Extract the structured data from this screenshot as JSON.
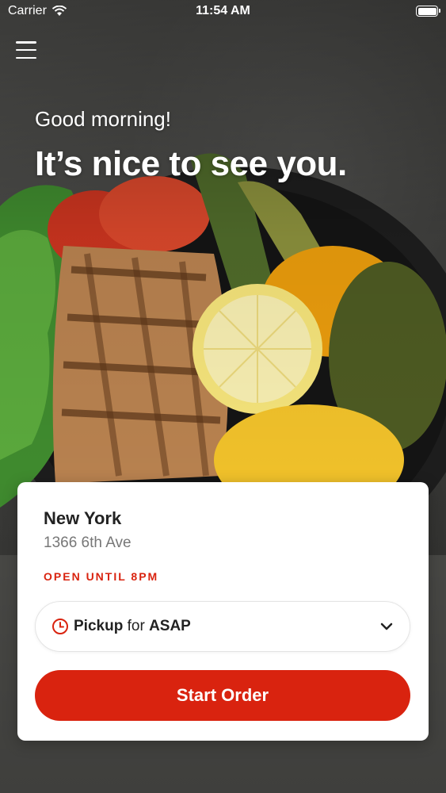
{
  "status_bar": {
    "carrier": "Carrier",
    "time": "11:54 AM"
  },
  "header": {
    "menu_icon": "hamburger-menu-icon",
    "greeting": "Good morning!",
    "headline": "It’s nice to see you."
  },
  "location": {
    "name": "New York",
    "address": "1366 6th Ave",
    "hours": "OPEN UNTIL 8PM"
  },
  "order_mode": {
    "icon": "clock-icon",
    "mode": "Pickup",
    "connector": "for",
    "time": "ASAP",
    "dropdown_icon": "chevron-down-icon"
  },
  "actions": {
    "start_order": "Start Order"
  },
  "colors": {
    "accent": "#d9230f",
    "card_bg": "#ffffff",
    "text_primary": "#222222",
    "text_secondary": "#777777"
  }
}
